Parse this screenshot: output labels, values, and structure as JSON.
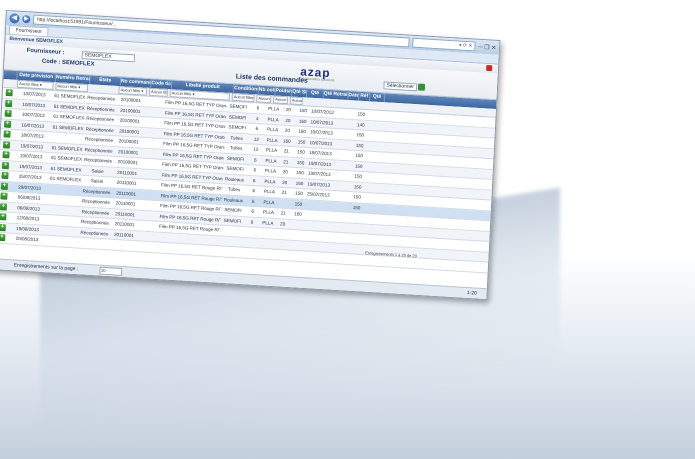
{
  "browser": {
    "url": "http://localhost:51991/Fournisseur/...",
    "tab_title": "Fournisseur"
  },
  "app": {
    "user": "Bienvenue SEMOFLEX",
    "logo": "azap",
    "logo_sub": "les nouvelles solutions",
    "page_title": "Liste des commandes",
    "fournisseur_label": "Fournisseur :",
    "fournisseur_value": "SEMOFLEX",
    "code_label": "Code : SEMOFLEX",
    "right_select": "Sélectionner"
  },
  "columns": [
    "Date prevision",
    "Numéro Retrait",
    "Etats",
    "No commande",
    "Code ticket",
    "Libellé produit",
    "Conditionné",
    "Nb colis",
    "Poids/colis",
    "Qté SFT",
    "Qté",
    "Qté Retrait",
    "Date",
    "Réf",
    "Qté"
  ],
  "filters": [
    "Aucun filtre",
    "Aucun filtre",
    "",
    "Aucun filtre",
    "Aucun filtre",
    "Aucun filtre",
    "Aucun filtre",
    "Aucun filtre",
    "Aucun filtre",
    "Aucun filtre"
  ],
  "rows": [
    [
      "10/07/2013",
      "61 SEMOFLEX",
      "Réceptionnée",
      "20100001",
      "",
      "Film PP 16,5G RET TYP Orange R/T",
      "SEMOFI",
      "6",
      "PLLA",
      "20",
      "150",
      "10/07/2013",
      "",
      "",
      "150"
    ],
    [
      "10/07/2013",
      "61 SEMOFLEX",
      "Réceptionnée",
      "20100001",
      "",
      "Film PP 16,5G RET TYP Orange R/T",
      "SEMOFI",
      "4",
      "PLLA",
      "20",
      "160",
      "10/07/2013",
      "",
      "",
      "140"
    ],
    [
      "10/07/2013",
      "61 SEMOFLEX",
      "Réceptionnée",
      "20100001",
      "",
      "Film PP 16,5G RET TYP Orange R/T",
      "SEMOFI",
      "6",
      "PLLA",
      "20",
      "160",
      "10/07/2013",
      "",
      "",
      "150"
    ],
    [
      "10/07/2013",
      "61 SEMOFLEX",
      "Réceptionnée",
      "20100001",
      "",
      "Film PP 16,5G RET TYP Orange R/T",
      "Tubes",
      "12",
      "PLLA",
      "160",
      "150",
      "10/07/2013",
      "",
      "",
      "150"
    ],
    [
      "18/07/2013",
      "",
      "Réceptionnée",
      "20100001",
      "",
      "Film PP 16,5G RET TYP Orange R/T",
      "Tubes",
      "12",
      "PLLA",
      "21",
      "150",
      "18/07/2013",
      "",
      "",
      "150"
    ],
    [
      "19/07/2013",
      "61 SEMOFLEX",
      "Réceptionnée",
      "20100001",
      "",
      "Film PP 16,5G RET TYP Orange R/T",
      "SEMOFI",
      "6",
      "PLLA",
      "21",
      "150",
      "19/07/2013",
      "",
      "",
      "150"
    ],
    [
      "19/07/2013",
      "61 SEMOFLEX",
      "Réceptionnée",
      "20100001",
      "",
      "Film PP 16,5G RET TYP Orange R/T",
      "SEMOFI",
      "6",
      "PLLA",
      "20",
      "150",
      "19/07/2013",
      "",
      "",
      "150"
    ],
    [
      "19/07/2013",
      "61 SEMOFLEX",
      "Saisie",
      "20110001",
      "",
      "Film PP 16,5G RET TYP Orange R/T",
      "Rouleaux",
      "6",
      "PLLA",
      "20",
      "160",
      "19/07/2013",
      "",
      "",
      "150"
    ],
    [
      "25/07/2013",
      "61 SEMOFLEX",
      "Saisie",
      "20110001",
      "",
      "Film PP 16,5G RET Rouge R/T",
      "Tubes",
      "6",
      "PLLA",
      "21",
      "150",
      "25/07/2013",
      "",
      "",
      "150"
    ],
    [
      "29/07/2013",
      "",
      "Réceptionnée",
      "20110001",
      "",
      "Film PP 16,5G RET Rouge R/T",
      "Rouleaux",
      "6",
      "PLLA",
      "",
      "150",
      "",
      "",
      "",
      "150"
    ],
    [
      "06/08/2013",
      "",
      "Réceptionnée",
      "20110001",
      "",
      "Film PP 16,5G RET Rouge R/T",
      "SEMOFI",
      "6",
      "PLLA",
      "21",
      "160",
      "",
      "",
      "",
      ""
    ],
    [
      "06/08/2013",
      "",
      "Réceptionnée",
      "20110001",
      "",
      "Film PP 16,5G RET Rouge R/T",
      "SEMOFI",
      "6",
      "PLLA",
      "20",
      "",
      "",
      "",
      "",
      ""
    ],
    [
      "12/08/2013",
      "",
      "Réceptionnée",
      "20110001",
      "",
      "Film PP 16,5G RET Rouge R/T",
      "",
      "",
      "",
      "",
      "",
      "",
      "",
      "",
      ""
    ],
    [
      "19/08/2013",
      "",
      "Réceptionnée",
      "20110001",
      "",
      "",
      "",
      "",
      "",
      "",
      "",
      "",
      "",
      "",
      ""
    ],
    [
      "20/08/2013",
      "",
      "",
      "",
      "",
      "",
      "",
      "",
      "",
      "",
      "",
      "",
      "",
      "",
      ""
    ]
  ],
  "footer": {
    "label": "Enregistrements sur la page :",
    "page_size": "20",
    "count": "1-20",
    "pager": "Enregistrements 1 à 20 de 20"
  }
}
